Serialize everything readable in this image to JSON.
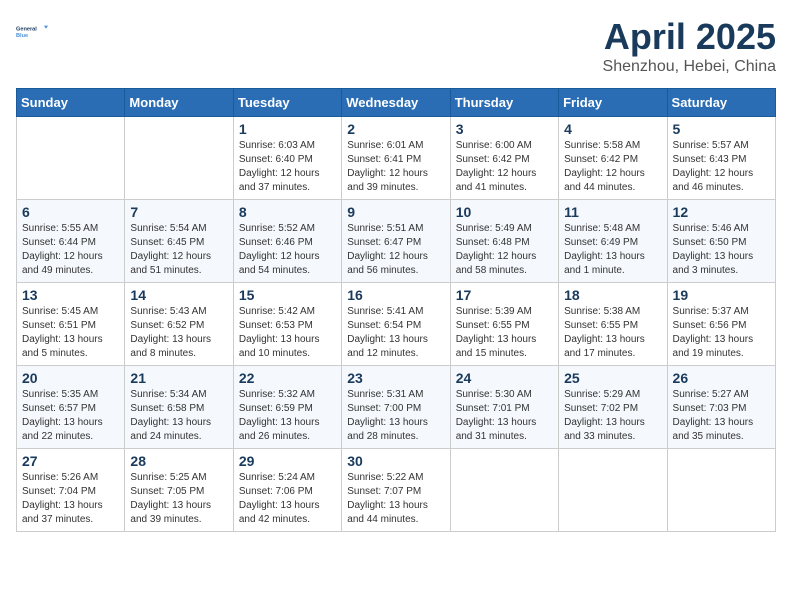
{
  "logo": {
    "text_general": "General",
    "text_blue": "Blue"
  },
  "title": "April 2025",
  "subtitle": "Shenzhou, Hebei, China",
  "weekdays": [
    "Sunday",
    "Monday",
    "Tuesday",
    "Wednesday",
    "Thursday",
    "Friday",
    "Saturday"
  ],
  "weeks": [
    [
      {
        "day": "",
        "info": ""
      },
      {
        "day": "",
        "info": ""
      },
      {
        "day": "1",
        "info": "Sunrise: 6:03 AM\nSunset: 6:40 PM\nDaylight: 12 hours and 37 minutes."
      },
      {
        "day": "2",
        "info": "Sunrise: 6:01 AM\nSunset: 6:41 PM\nDaylight: 12 hours and 39 minutes."
      },
      {
        "day": "3",
        "info": "Sunrise: 6:00 AM\nSunset: 6:42 PM\nDaylight: 12 hours and 41 minutes."
      },
      {
        "day": "4",
        "info": "Sunrise: 5:58 AM\nSunset: 6:42 PM\nDaylight: 12 hours and 44 minutes."
      },
      {
        "day": "5",
        "info": "Sunrise: 5:57 AM\nSunset: 6:43 PM\nDaylight: 12 hours and 46 minutes."
      }
    ],
    [
      {
        "day": "6",
        "info": "Sunrise: 5:55 AM\nSunset: 6:44 PM\nDaylight: 12 hours and 49 minutes."
      },
      {
        "day": "7",
        "info": "Sunrise: 5:54 AM\nSunset: 6:45 PM\nDaylight: 12 hours and 51 minutes."
      },
      {
        "day": "8",
        "info": "Sunrise: 5:52 AM\nSunset: 6:46 PM\nDaylight: 12 hours and 54 minutes."
      },
      {
        "day": "9",
        "info": "Sunrise: 5:51 AM\nSunset: 6:47 PM\nDaylight: 12 hours and 56 minutes."
      },
      {
        "day": "10",
        "info": "Sunrise: 5:49 AM\nSunset: 6:48 PM\nDaylight: 12 hours and 58 minutes."
      },
      {
        "day": "11",
        "info": "Sunrise: 5:48 AM\nSunset: 6:49 PM\nDaylight: 13 hours and 1 minute."
      },
      {
        "day": "12",
        "info": "Sunrise: 5:46 AM\nSunset: 6:50 PM\nDaylight: 13 hours and 3 minutes."
      }
    ],
    [
      {
        "day": "13",
        "info": "Sunrise: 5:45 AM\nSunset: 6:51 PM\nDaylight: 13 hours and 5 minutes."
      },
      {
        "day": "14",
        "info": "Sunrise: 5:43 AM\nSunset: 6:52 PM\nDaylight: 13 hours and 8 minutes."
      },
      {
        "day": "15",
        "info": "Sunrise: 5:42 AM\nSunset: 6:53 PM\nDaylight: 13 hours and 10 minutes."
      },
      {
        "day": "16",
        "info": "Sunrise: 5:41 AM\nSunset: 6:54 PM\nDaylight: 13 hours and 12 minutes."
      },
      {
        "day": "17",
        "info": "Sunrise: 5:39 AM\nSunset: 6:55 PM\nDaylight: 13 hours and 15 minutes."
      },
      {
        "day": "18",
        "info": "Sunrise: 5:38 AM\nSunset: 6:55 PM\nDaylight: 13 hours and 17 minutes."
      },
      {
        "day": "19",
        "info": "Sunrise: 5:37 AM\nSunset: 6:56 PM\nDaylight: 13 hours and 19 minutes."
      }
    ],
    [
      {
        "day": "20",
        "info": "Sunrise: 5:35 AM\nSunset: 6:57 PM\nDaylight: 13 hours and 22 minutes."
      },
      {
        "day": "21",
        "info": "Sunrise: 5:34 AM\nSunset: 6:58 PM\nDaylight: 13 hours and 24 minutes."
      },
      {
        "day": "22",
        "info": "Sunrise: 5:32 AM\nSunset: 6:59 PM\nDaylight: 13 hours and 26 minutes."
      },
      {
        "day": "23",
        "info": "Sunrise: 5:31 AM\nSunset: 7:00 PM\nDaylight: 13 hours and 28 minutes."
      },
      {
        "day": "24",
        "info": "Sunrise: 5:30 AM\nSunset: 7:01 PM\nDaylight: 13 hours and 31 minutes."
      },
      {
        "day": "25",
        "info": "Sunrise: 5:29 AM\nSunset: 7:02 PM\nDaylight: 13 hours and 33 minutes."
      },
      {
        "day": "26",
        "info": "Sunrise: 5:27 AM\nSunset: 7:03 PM\nDaylight: 13 hours and 35 minutes."
      }
    ],
    [
      {
        "day": "27",
        "info": "Sunrise: 5:26 AM\nSunset: 7:04 PM\nDaylight: 13 hours and 37 minutes."
      },
      {
        "day": "28",
        "info": "Sunrise: 5:25 AM\nSunset: 7:05 PM\nDaylight: 13 hours and 39 minutes."
      },
      {
        "day": "29",
        "info": "Sunrise: 5:24 AM\nSunset: 7:06 PM\nDaylight: 13 hours and 42 minutes."
      },
      {
        "day": "30",
        "info": "Sunrise: 5:22 AM\nSunset: 7:07 PM\nDaylight: 13 hours and 44 minutes."
      },
      {
        "day": "",
        "info": ""
      },
      {
        "day": "",
        "info": ""
      },
      {
        "day": "",
        "info": ""
      }
    ]
  ]
}
